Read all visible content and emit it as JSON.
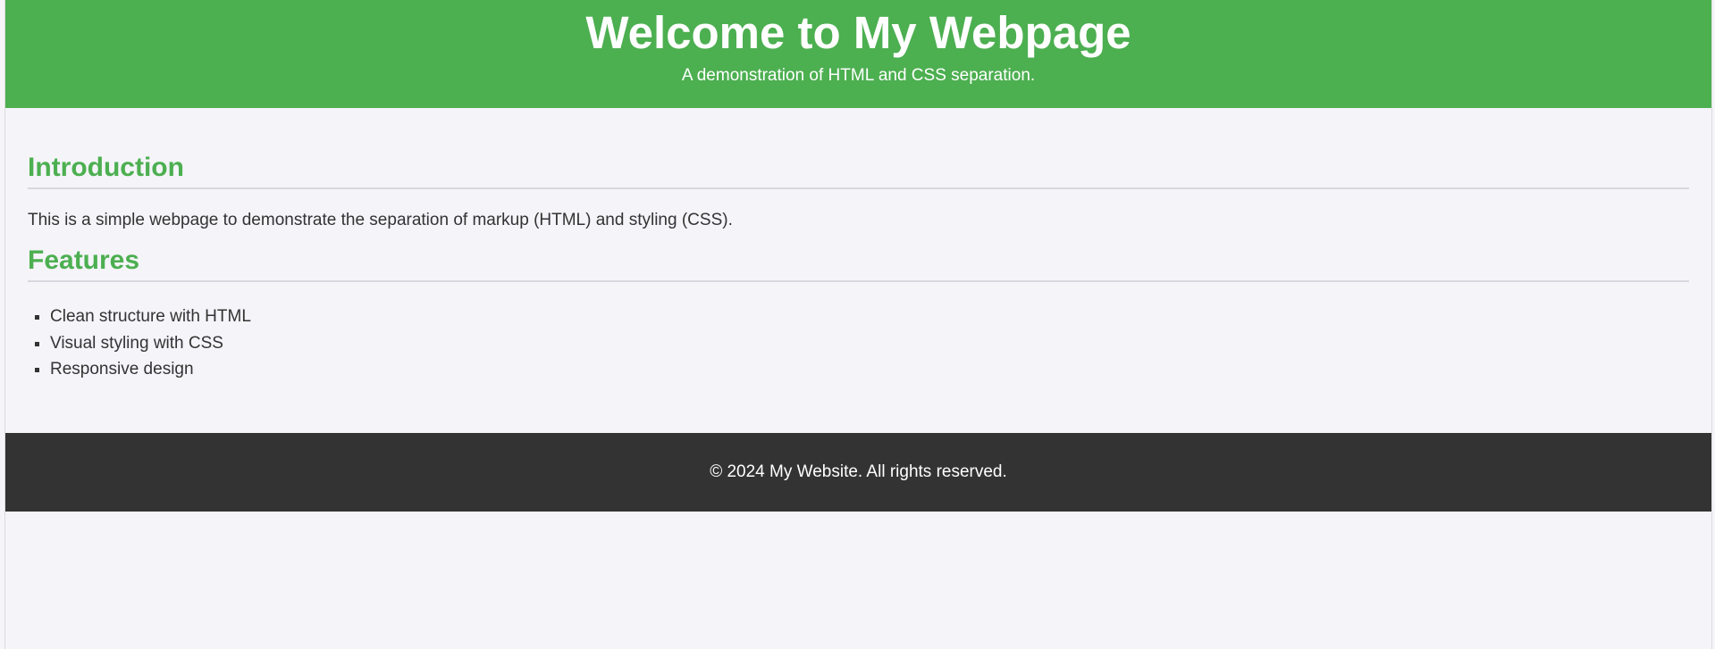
{
  "header": {
    "title": "Welcome to My Webpage",
    "subtitle": "A demonstration of HTML and CSS separation."
  },
  "intro": {
    "heading": "Introduction",
    "text": "This is a simple webpage to demonstrate the separation of markup (HTML) and styling (CSS)."
  },
  "features": {
    "heading": "Features",
    "items": [
      "Clean structure with HTML",
      "Visual styling with CSS",
      "Responsive design"
    ]
  },
  "footer": {
    "text": "© 2024 My Website. All rights reserved."
  },
  "colors": {
    "accent": "#4caf50",
    "footer_bg": "#333333",
    "page_bg": "#f4f4f9",
    "text": "#333333"
  }
}
